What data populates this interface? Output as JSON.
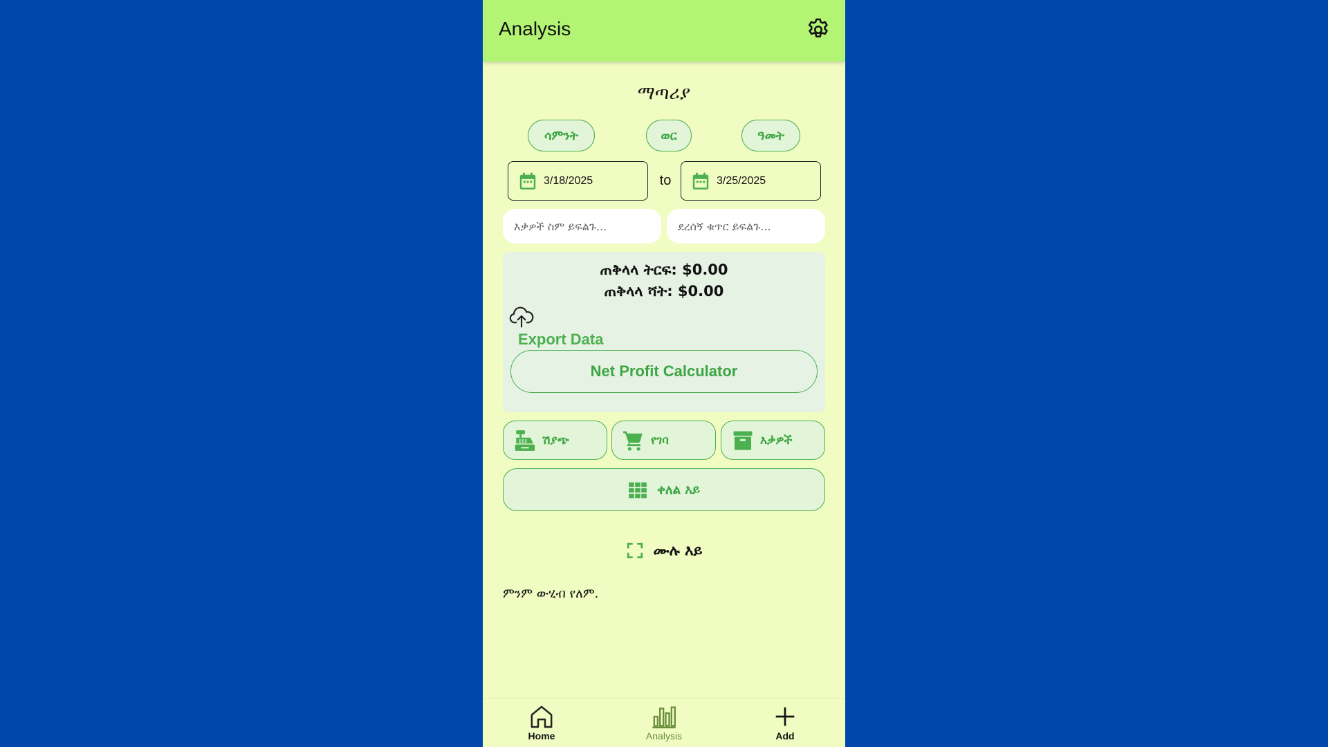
{
  "appbar": {
    "title": "Analysis"
  },
  "filter": {
    "section_title": "ማጣሪያ",
    "range_buttons": [
      "ሳምንት",
      "ወር",
      "ዓመት"
    ],
    "start_date": "3/18/2025",
    "to_label": "to",
    "end_date": "3/25/2025",
    "item_search_placeholder": "እቃዎች ስም ይፍልጉ...",
    "receipt_search_placeholder": "ደረሰኝ ቁጥር ይፍልጉ..."
  },
  "summary": {
    "total_profit": "ጠቅላላ ትርፍ: $0.00",
    "total_sales": "ጠቅላላ ሻት: $0.00",
    "export_label": "Export Data",
    "net_profit_button": "Net Profit Calculator"
  },
  "categories": {
    "sales": "ሽያጭ",
    "purchase": "የገባ",
    "items": "እቃዎች",
    "simple_view": "ቀለል እይ"
  },
  "full_view_label": "ሙሉ እይ",
  "empty_message": "ምንም ውሂብ የለም.",
  "bottom_nav": {
    "home": "Home",
    "analysis": "Analysis",
    "add": "Add"
  },
  "colors": {
    "page_background": "#0047AB",
    "app_background": "#F1FCC2",
    "appbar": "#B3F474",
    "accent_green": "#4CAF50",
    "active_nav": "#6B8E3D"
  },
  "icons": [
    "settings-icon",
    "calendar-icon",
    "cloud-upload-icon",
    "cash-register-icon",
    "cart-icon",
    "archive-icon",
    "grid-icon",
    "fullscreen-icon",
    "home-icon",
    "bar-chart-icon",
    "plus-icon"
  ]
}
